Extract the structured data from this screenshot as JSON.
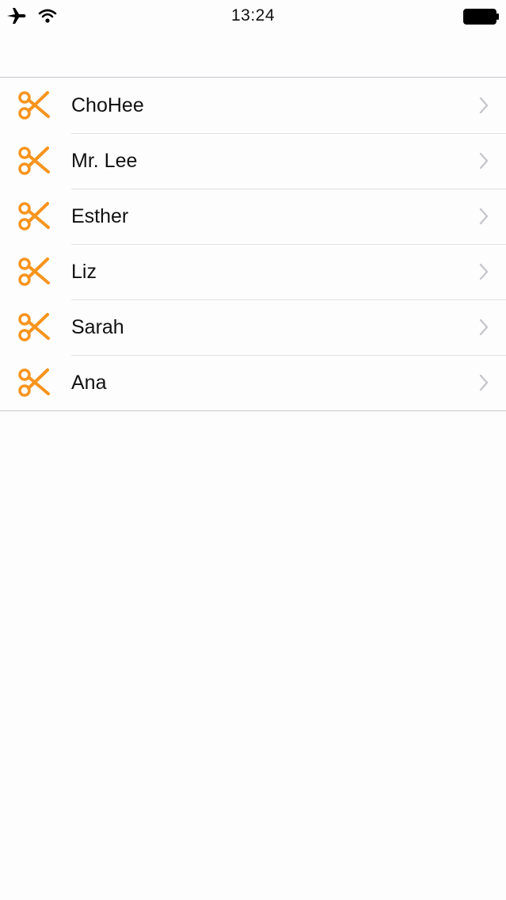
{
  "status_bar": {
    "time": "13:24",
    "icons": [
      "airplane-icon",
      "wifi-icon",
      "battery-icon"
    ]
  },
  "list": {
    "items": [
      {
        "label": "ChoHee",
        "icon": "scissors-icon"
      },
      {
        "label": "Mr. Lee",
        "icon": "scissors-icon"
      },
      {
        "label": "Esther",
        "icon": "scissors-icon"
      },
      {
        "label": "Liz",
        "icon": "scissors-icon"
      },
      {
        "label": "Sarah",
        "icon": "scissors-icon"
      },
      {
        "label": "Ana",
        "icon": "scissors-icon"
      }
    ]
  },
  "colors": {
    "accent": "#f7941d",
    "chevron": "#c7c7cc",
    "separator": "#c8c7cc"
  }
}
